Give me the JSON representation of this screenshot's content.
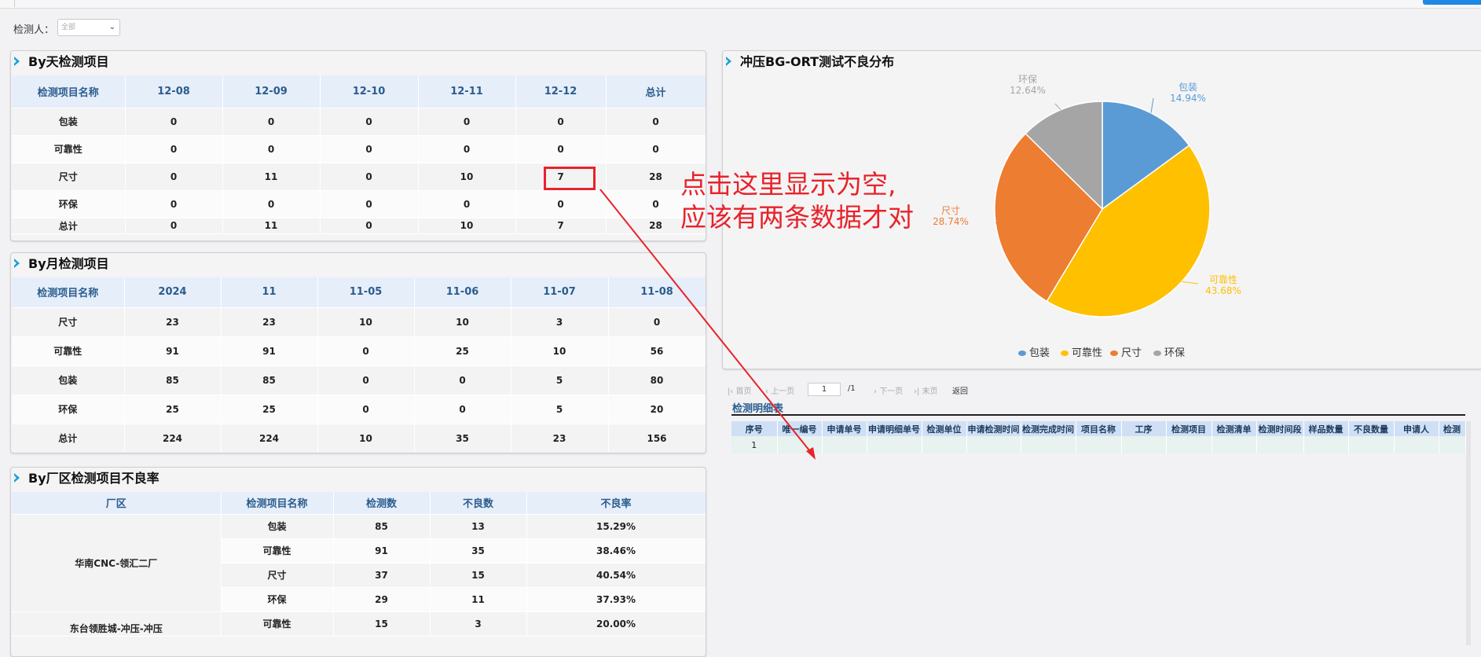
{
  "filter": {
    "label": "检测人：",
    "value": "全部"
  },
  "daily": {
    "title": "By天检测项目",
    "headers": [
      "检测项目名称",
      "12-08",
      "12-09",
      "12-10",
      "12-11",
      "12-12",
      "总计"
    ],
    "rows": [
      [
        "包装",
        "0",
        "0",
        "0",
        "0",
        "0",
        "0"
      ],
      [
        "可靠性",
        "0",
        "0",
        "0",
        "0",
        "0",
        "0"
      ],
      [
        "尺寸",
        "0",
        "11",
        "0",
        "10",
        "7",
        "28"
      ],
      [
        "环保",
        "0",
        "0",
        "0",
        "0",
        "0",
        "0"
      ],
      [
        "总计",
        "0",
        "11",
        "0",
        "10",
        "7",
        "28"
      ]
    ]
  },
  "monthly": {
    "title": "By月检测项目",
    "headers": [
      "检测项目名称",
      "2024",
      "11",
      "11-05",
      "11-06",
      "11-07",
      "11-08"
    ],
    "rows": [
      [
        "尺寸",
        "23",
        "23",
        "10",
        "10",
        "3",
        "0"
      ],
      [
        "可靠性",
        "91",
        "91",
        "0",
        "25",
        "10",
        "56"
      ],
      [
        "包装",
        "85",
        "85",
        "0",
        "0",
        "5",
        "80"
      ],
      [
        "环保",
        "25",
        "25",
        "0",
        "0",
        "5",
        "20"
      ],
      [
        "总计",
        "224",
        "224",
        "10",
        "35",
        "23",
        "156"
      ]
    ]
  },
  "factory": {
    "title": "By厂区检测项目不良率",
    "headers": [
      "厂区",
      "检测项目名称",
      "检测数",
      "不良数",
      "不良率"
    ],
    "group1": "华南CNC-领汇二厂",
    "group2": "东台领胜城-冲压-冲压",
    "rows": [
      [
        "包装",
        "85",
        "13",
        "15.29%"
      ],
      [
        "可靠性",
        "91",
        "35",
        "38.46%"
      ],
      [
        "尺寸",
        "37",
        "15",
        "40.54%"
      ],
      [
        "环保",
        "29",
        "11",
        "37.93%"
      ],
      [
        "可靠性",
        "15",
        "3",
        "20.00%"
      ]
    ]
  },
  "pie_panel": {
    "title": "冲压BG-ORT测试不良分布"
  },
  "annotation": {
    "line1": "点击这里显示为空,",
    "line2": "应该有两条数据才对"
  },
  "pager": {
    "first": "首页",
    "prev": "上一页",
    "page": "1",
    "total": "/1",
    "next": "下一页",
    "last": "末页",
    "back": "返回"
  },
  "detail": {
    "title": "检测明细表",
    "headers": [
      "序号",
      "唯一编号",
      "申请单号",
      "申请明细单号",
      "检测单位",
      "申请检测时间",
      "检测完成时间",
      "项目名称",
      "工序",
      "检测项目",
      "检测清单",
      "检测时间段",
      "样品数量",
      "不良数量",
      "申请人",
      "检测"
    ],
    "row1_index": "1"
  },
  "colors": {
    "accent": "#13a0d8",
    "annotation": "#e8232a",
    "header_bg": "#e6eefa"
  },
  "chart_data": {
    "type": "pie",
    "title": "冲压BG-ORT测试不良分布",
    "slices": [
      {
        "label": "包装",
        "value": 14.94,
        "text": "14.94%",
        "color": "#5b9bd5"
      },
      {
        "label": "可靠性",
        "value": 43.68,
        "text": "43.68%",
        "color": "#ffc000"
      },
      {
        "label": "尺寸",
        "value": 28.74,
        "text": "28.74%",
        "color": "#ed7d31"
      },
      {
        "label": "环保",
        "value": 12.64,
        "text": "12.64%",
        "color": "#a5a5a5"
      }
    ],
    "legend": "bottom"
  }
}
